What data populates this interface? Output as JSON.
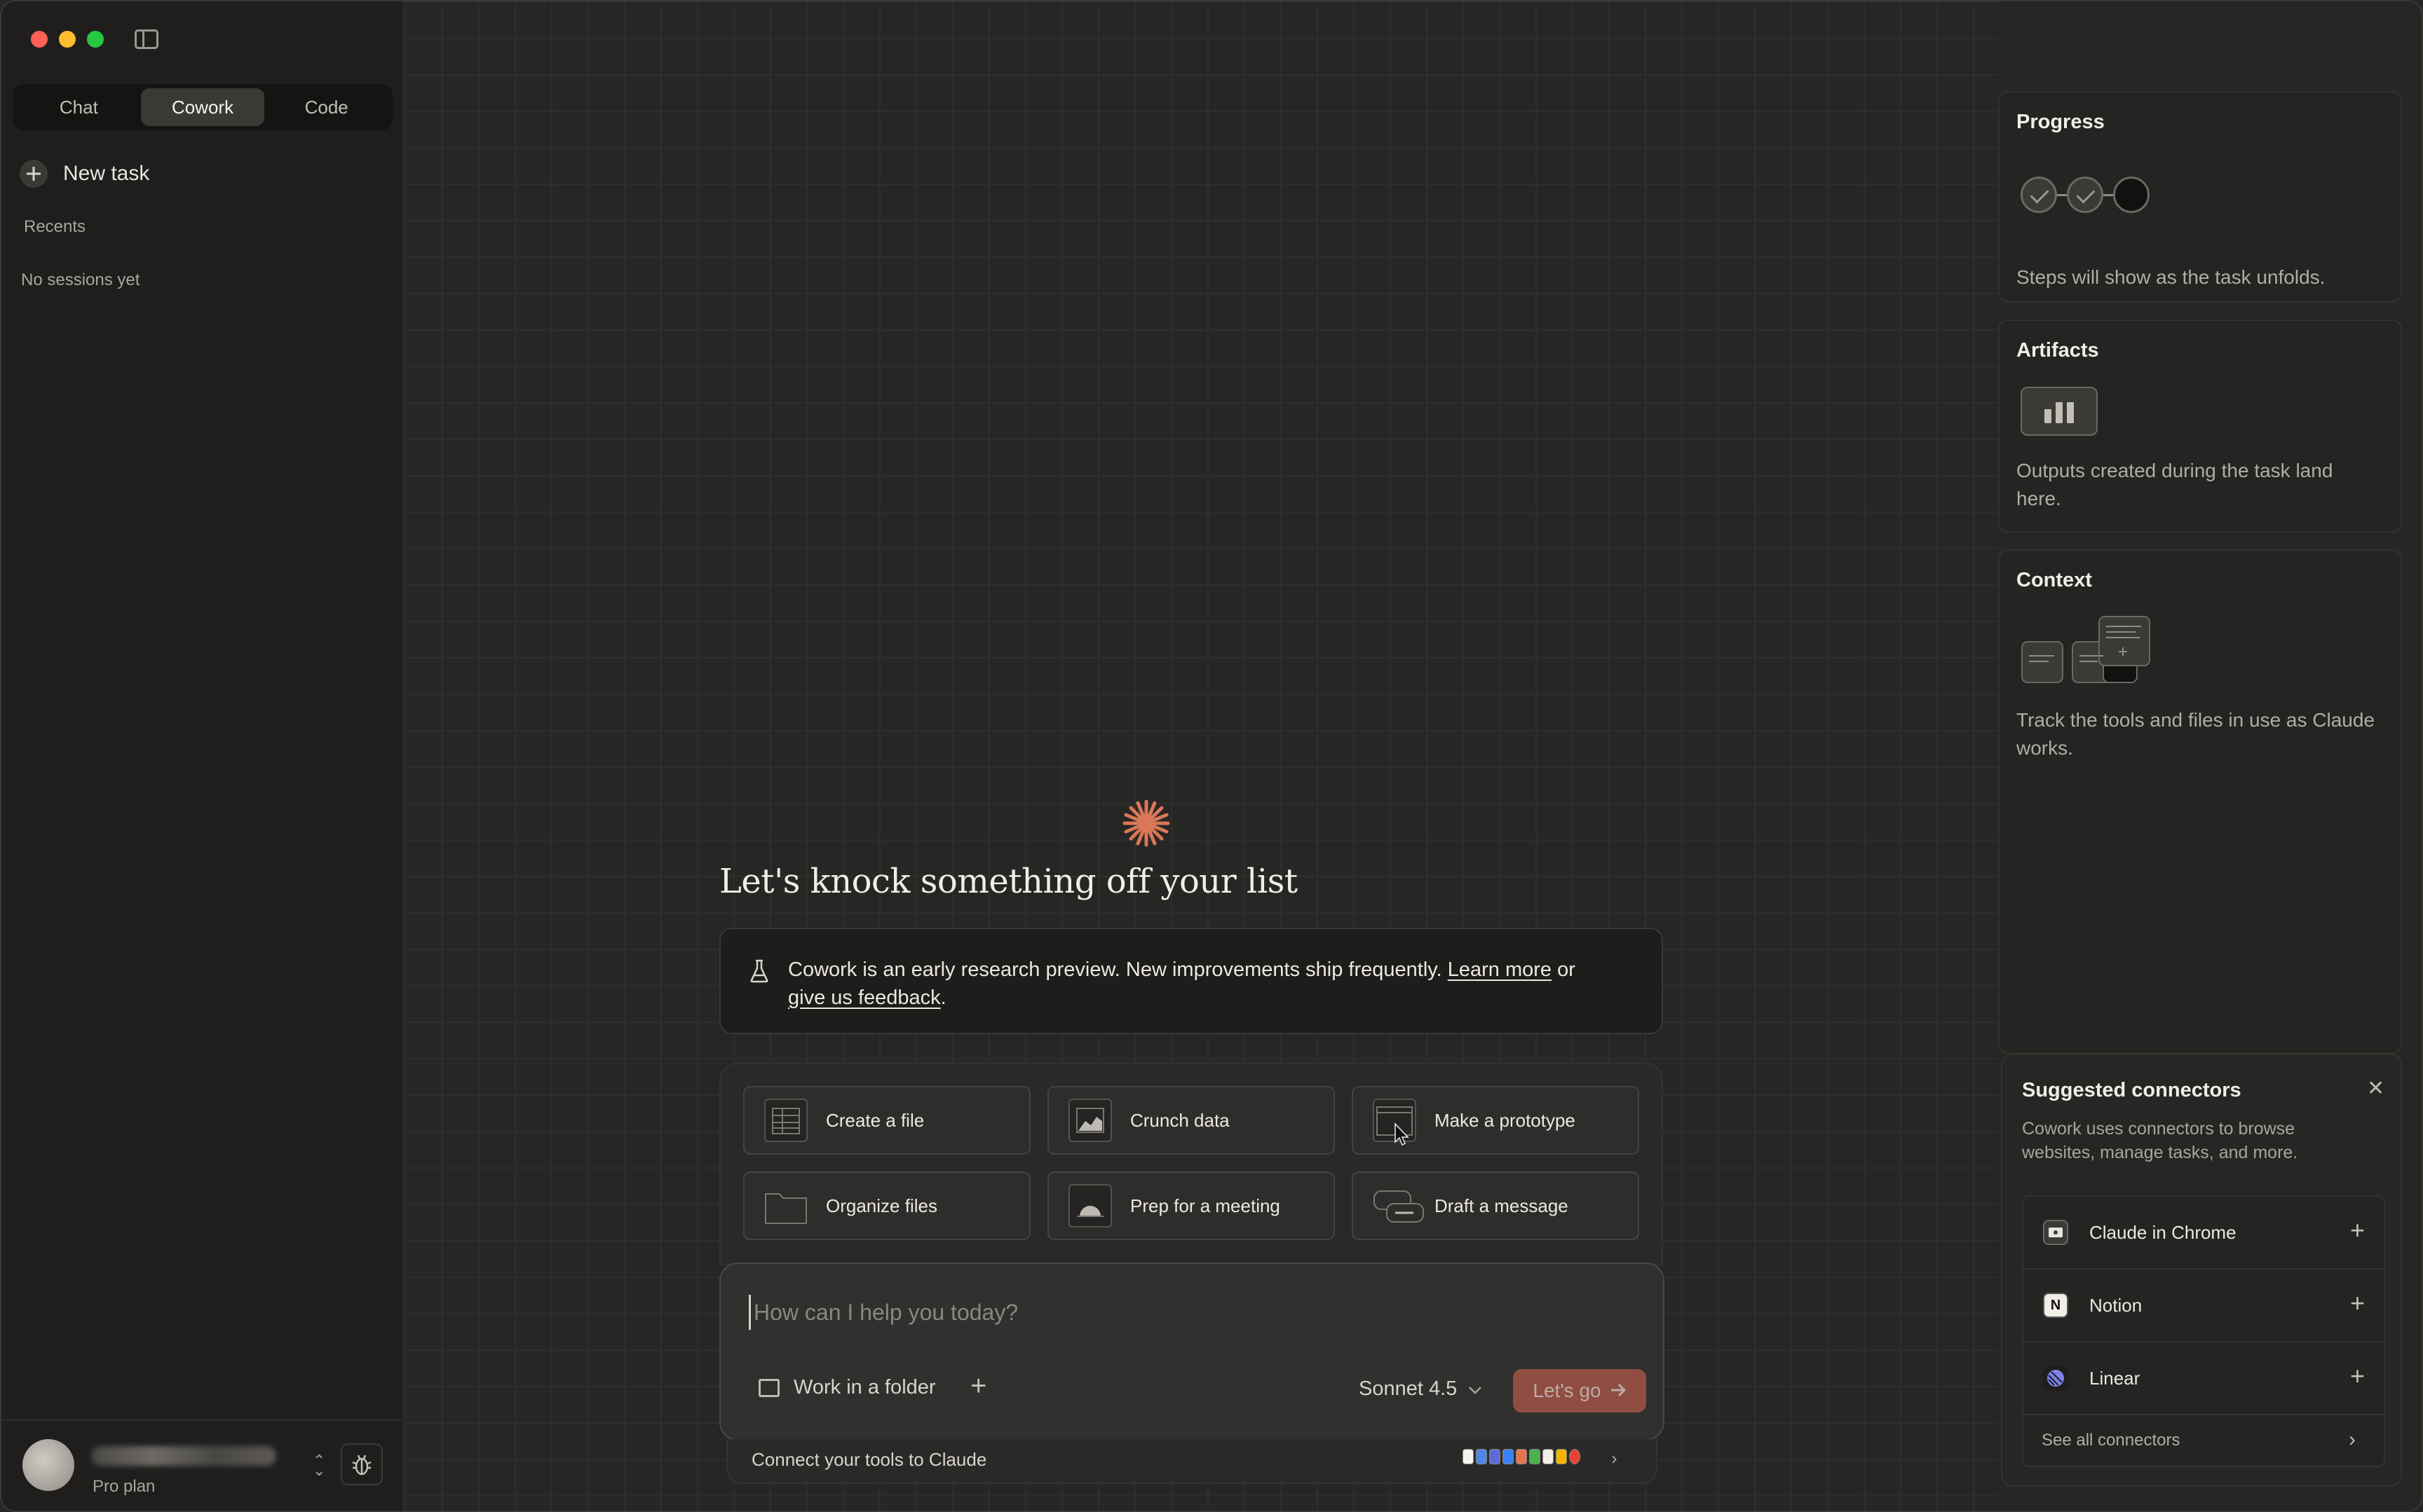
{
  "sidebar": {
    "mode_tabs": [
      {
        "label": "Chat",
        "active": false
      },
      {
        "label": "Cowork",
        "active": true
      },
      {
        "label": "Code",
        "active": false
      }
    ],
    "new_task_label": "New task",
    "recents_label": "Recents",
    "empty_sessions_text": "No sessions yet",
    "footer": {
      "plan": "Pro plan"
    }
  },
  "main": {
    "headline": "Let's knock something off your list",
    "notice": {
      "text": "Cowork is an early research preview. New improvements ship frequently.",
      "learn_more": "Learn more",
      "or": "or",
      "feedback": "give us feedback",
      "period": "."
    },
    "suggestions": [
      {
        "label": "Create a file",
        "icon": "spreadsheet-icon"
      },
      {
        "label": "Crunch data",
        "icon": "chart-icon"
      },
      {
        "label": "Make a prototype",
        "icon": "browser-window-icon"
      },
      {
        "label": "Organize files",
        "icon": "folder-icon"
      },
      {
        "label": "Prep for a meeting",
        "icon": "calendar-icon"
      },
      {
        "label": "Draft a message",
        "icon": "message-icon"
      }
    ],
    "prompt": {
      "placeholder": "How can I help you today?",
      "folder_label": "Work in a folder",
      "model": "Sonnet 4.5",
      "submit_label": "Let's go"
    },
    "connect_bar_text": "Connect your tools to Claude"
  },
  "right_panel": {
    "progress": {
      "title": "Progress",
      "description": "Steps will show as the task unfolds.",
      "steps_completed": 2,
      "steps_total": 3
    },
    "artifacts": {
      "title": "Artifacts",
      "description": "Outputs created during the task land here."
    },
    "context": {
      "title": "Context",
      "description": "Track the tools and files in use as Claude works."
    },
    "connectors": {
      "title": "Suggested connectors",
      "description": "Cowork uses connectors to browse websites, manage tasks, and more.",
      "items": [
        {
          "name": "Claude in Chrome",
          "icon": "chrome-extension-icon"
        },
        {
          "name": "Notion",
          "icon": "notion-icon"
        },
        {
          "name": "Linear",
          "icon": "linear-icon"
        }
      ],
      "see_all_label": "See all connectors"
    }
  },
  "colors": {
    "accent": "#d97757",
    "submit_button": "#b5594a",
    "background": "#262624",
    "sidebar": "#1f1e1d"
  }
}
